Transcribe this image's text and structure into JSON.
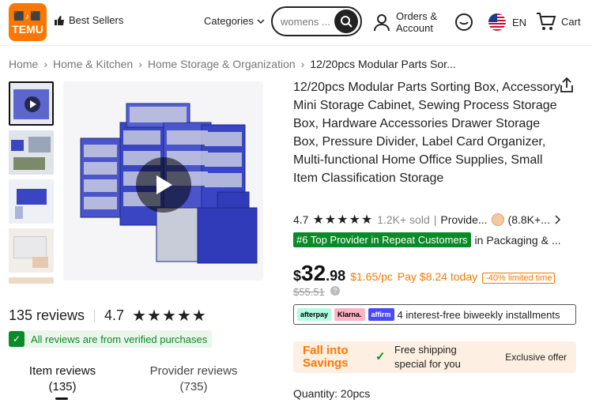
{
  "header": {
    "logo_text": "TEMU",
    "logo_glyphs": "⬛♪⬛",
    "best_sellers": "Best Sellers",
    "categories": "Categories",
    "search_value": "womens ...",
    "orders_line1": "Orders &",
    "orders_line2": "Account",
    "lang": "EN",
    "cart": "Cart"
  },
  "breadcrumb": {
    "items": [
      "Home",
      "Home & Kitchen",
      "Home Storage & Organization",
      "12/20pcs Modular Parts Sor..."
    ],
    "sep": "›"
  },
  "product": {
    "title": "12/20pcs Modular Parts Sorting Box, Accessory Mini Storage Cabinet, Sewing Process Storage Box, Hardware Accessories Drawer Storage Box, Pressure Divider, Label Card Organizer, Multi-functional Home Office Supplies, Small Item Classification Storage",
    "rating": "4.7",
    "stars": "★★★★★",
    "sold": "1.2K+ sold",
    "sep": "|",
    "provider": "Provide...",
    "provider_count": "(8.8K+...",
    "rank_badge": "#6 Top Provider in Repeat Customers",
    "rank_suffix": "in Packaging & ...",
    "price_currency": "$",
    "price_int": "32",
    "price_cents": ".98",
    "per_pc": "$1.65/pc",
    "pay_today": "Pay $8.24 today",
    "discount": "-40% limited time",
    "original_price": "$55.51",
    "qmark": "?",
    "pay_badges": [
      "afterpay",
      "Klarna.",
      "affirm"
    ],
    "installments": "4 interest-free biweekly installments",
    "promo_title1": "Fall into",
    "promo_title2": "Savings",
    "free_shipping1": "Free shipping",
    "free_shipping2": "special for you",
    "exclusive": "Exclusive offer",
    "quantity": "Quantity: 20pcs"
  },
  "reviews": {
    "count_label": "135 reviews",
    "sep": "|",
    "rating": "4.7",
    "stars": "★★★★★",
    "verified": "All reviews are from verified purchases",
    "tab_item": "Item reviews",
    "tab_item_count": "(135)",
    "tab_provider": "Provider reviews",
    "tab_provider_count": "(735)"
  },
  "colors": {
    "brand": "#fb7701",
    "green": "#0a8a28",
    "product_blue": "#3a45c4"
  }
}
